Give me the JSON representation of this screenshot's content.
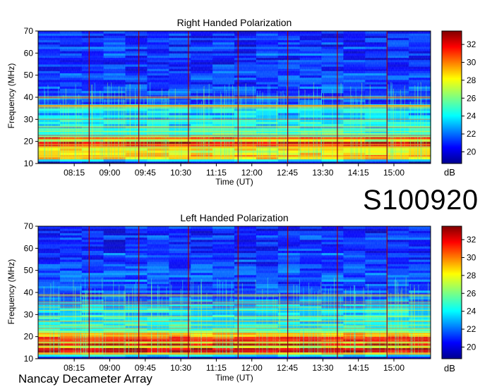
{
  "observation_id": "S100920",
  "footer_label": "Nancay Decameter Array",
  "chart_data": [
    {
      "type": "heatmap",
      "title": "Right Handed Polarization",
      "xlabel": "Time (UT)",
      "ylabel": "Frequency (MHz)",
      "xticks": [
        "08:15",
        "09:00",
        "09:45",
        "10:30",
        "11:15",
        "12:00",
        "12:45",
        "13:30",
        "14:15",
        "15:00"
      ],
      "yticks": [
        10,
        20,
        30,
        40,
        50,
        60,
        70
      ],
      "ylim": [
        10,
        70
      ],
      "colorbar": {
        "label": "dB",
        "ticks": [
          20,
          22,
          24,
          26,
          28,
          30,
          32
        ],
        "range": [
          18.7,
          33.5
        ],
        "colormap": "jet"
      },
      "vertical_markers": 7,
      "strong_emission_band_mhz": [
        12,
        22
      ],
      "moderate_emission_band_mhz": [
        22,
        37
      ]
    },
    {
      "type": "heatmap",
      "title": "Left Handed Polarization",
      "xlabel": "Time (UT)",
      "ylabel": "Frequency (MHz)",
      "xticks": [
        "08:15",
        "09:00",
        "09:45",
        "10:30",
        "11:15",
        "12:00",
        "12:45",
        "13:30",
        "14:15",
        "15:00"
      ],
      "yticks": [
        10,
        20,
        30,
        40,
        50,
        60,
        70
      ],
      "ylim": [
        10,
        70
      ],
      "colorbar": {
        "label": "dB",
        "ticks": [
          20,
          22,
          24,
          26,
          28,
          30,
          32
        ],
        "range": [
          18.7,
          33.5
        ],
        "colormap": "jet"
      },
      "vertical_markers": 7,
      "strong_emission_band_mhz": [
        12,
        22
      ],
      "moderate_emission_band_mhz": [
        22,
        37
      ]
    }
  ]
}
